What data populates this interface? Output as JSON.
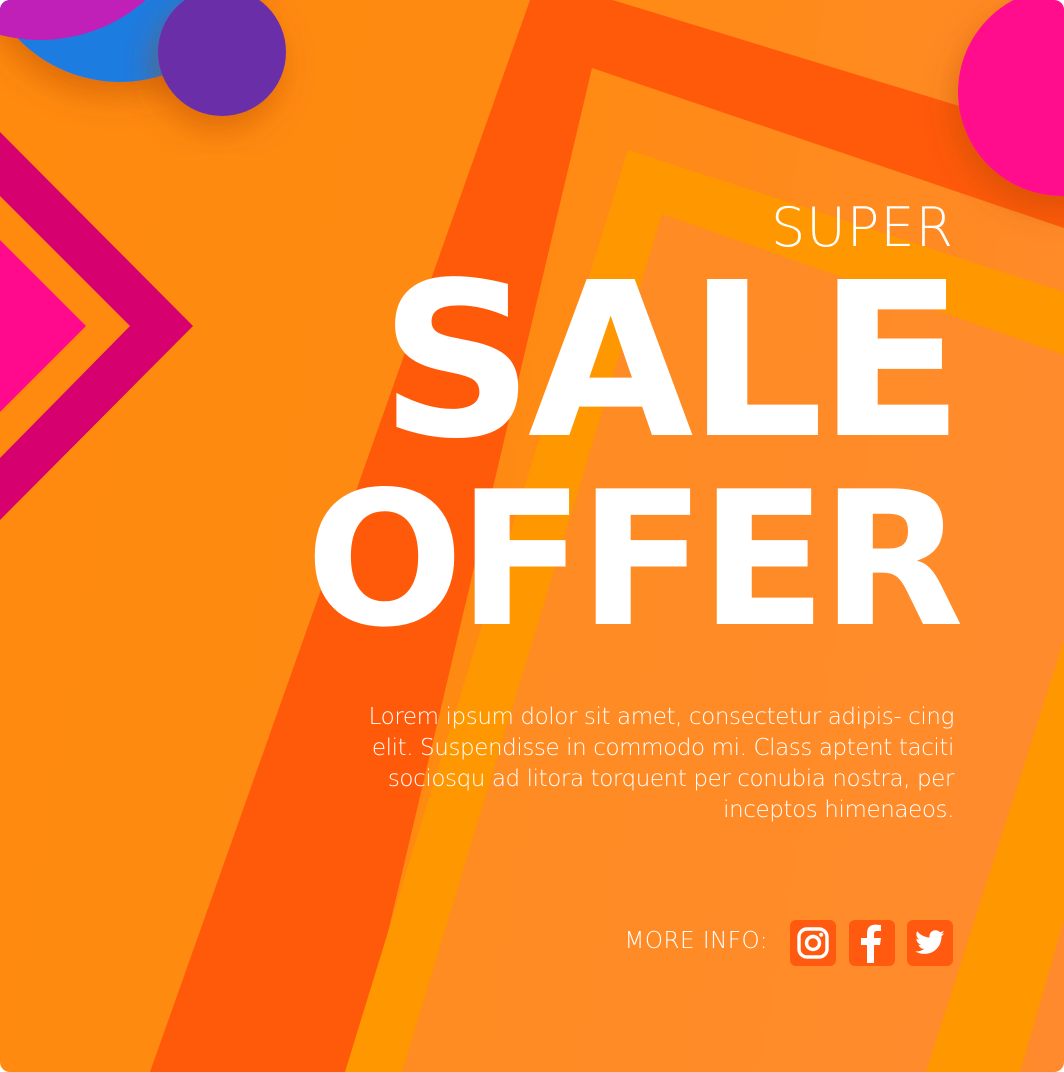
{
  "banner": {
    "super_text": "SUPER",
    "sale_text": "SALE",
    "offer_text": "OFFER",
    "body_text": "Lorem ipsum dolor sit amet, consectetur adipis- cing elit. Suspendisse in commodo mi. Class aptent taciti sociosqu ad litora torquent per conubia nostra, per inceptos himenaeos.",
    "more_info_label": "MORE INFO:"
  },
  "social_links": [
    {
      "icon": "instagram-icon"
    },
    {
      "icon": "facebook-icon"
    },
    {
      "icon": "twitter-icon"
    }
  ],
  "colors": {
    "background": "#ff8a12",
    "dark_orange_stripe": "#ff5a0a",
    "amber_stripe": "#ff9800",
    "magenta": "#ff0a8c",
    "dark_magenta": "#d6006e",
    "purple": "#6a2fa8",
    "blue": "#1e7be0",
    "text": "#ffffff",
    "icon_button_bg": "#ff5a0f"
  }
}
